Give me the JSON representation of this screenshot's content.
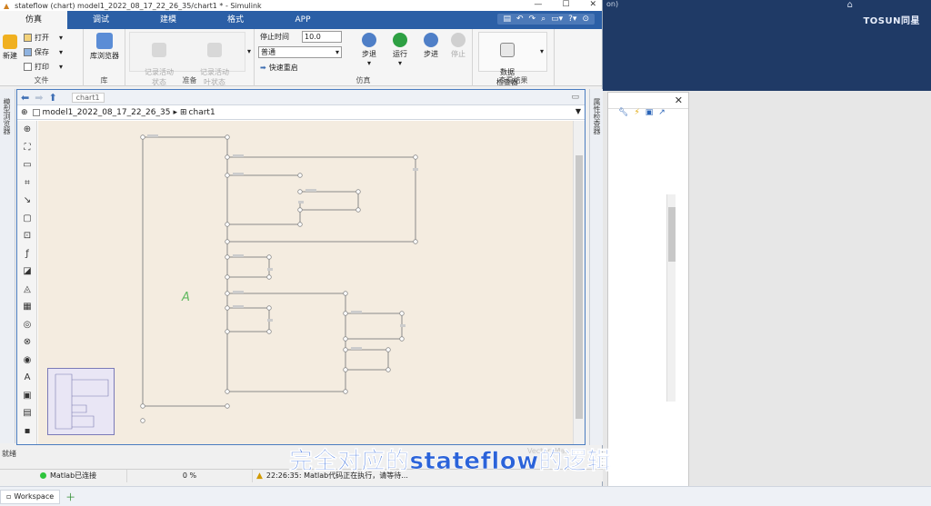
{
  "window": {
    "title": "stateflow (chart) model1_2022_08_17_22_26_35/chart1 * - Simulink",
    "controls": [
      "—",
      "☐",
      "✕"
    ]
  },
  "tabs": [
    {
      "label": "仿真",
      "active": true
    },
    {
      "label": "调试"
    },
    {
      "label": "建模"
    },
    {
      "label": "格式"
    },
    {
      "label": "APP"
    }
  ],
  "ribbon": {
    "file": {
      "new": "新建",
      "open": "打开",
      "save": "保存",
      "print": "打印",
      "group": "文件"
    },
    "library": {
      "label": "库浏览器",
      "group": "库"
    },
    "prepare": {
      "record_states": "记录活动\n状态",
      "record_leaves": "记录活动\n叶状态",
      "group": "准备"
    },
    "simulate": {
      "stop_time_label": "停止时间",
      "stop_time_value": "10.0",
      "mode": "普通",
      "fast_restart": "快速重启",
      "step_back": "步退",
      "run": "运行",
      "step_forward": "步进",
      "stop": "停止",
      "group": "仿真"
    },
    "results": {
      "inspector": "数据\n检查器",
      "group": "查看结果"
    }
  },
  "left_strip": {
    "label": "模型浏览器"
  },
  "right_strip": {
    "label": "属性检查器"
  },
  "editor": {
    "nav_chip": "chart1",
    "breadcrumb_model": "model1_2022_08_17_22_26_35",
    "breadcrumb_chart": "chart1"
  },
  "status": {
    "ready": "就绪",
    "matlab": "Matlab已连接",
    "progress_percent": 0,
    "progress_label": "0 %",
    "message": "22:26:35: Matlab代码正在执行，请等待..."
  },
  "taskbar": {
    "workspace": "Workspace"
  },
  "background_app": {
    "brand": "TOSUN同星",
    "titlebar_text": "on)"
  },
  "overlay": {
    "subtitle": "完全对应的stateflow的逻辑",
    "watermark": "Vector_Ma..."
  },
  "colors": {
    "tab_bar": "#2b5fa6",
    "canvas": "#f4ece0",
    "junction": "#8a8a8a",
    "subtitle": "#2b63d9",
    "bg_ribbon": "#1f3a66"
  }
}
